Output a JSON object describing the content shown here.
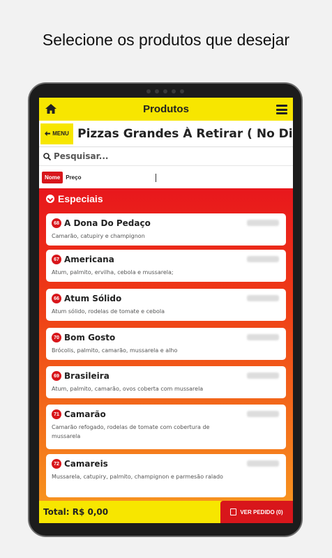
{
  "headline": "Selecione os produtos que desejar",
  "topbar": {
    "title": "Produtos"
  },
  "category": {
    "menu_label": "MENU",
    "title": "Pizzas Grandes À Retirar ( No Di..."
  },
  "search": {
    "placeholder": "Pesquisar..."
  },
  "sort": {
    "nome": "Nome",
    "preco": "Preço"
  },
  "section": {
    "title": "Especiais"
  },
  "products": [
    {
      "code": "68",
      "name": "A Dona Do Pedaço",
      "desc": "Camarão, catupiry e champignon"
    },
    {
      "code": "67",
      "name": "Americana",
      "desc": "Atum, palmito, ervilha, cebola e mussarela;"
    },
    {
      "code": "66",
      "name": "Atum Sólido",
      "desc": "Atum sólido, rodelas de tomate e cebola"
    },
    {
      "code": "70",
      "name": "Bom Gosto",
      "desc": "Brócolis, palmito, camarão, mussarela e alho"
    },
    {
      "code": "69",
      "name": "Brasileira",
      "desc": "Atum, palmito, camarão, ovos coberta com mussarela"
    },
    {
      "code": "71",
      "name": "Camarão",
      "desc": "Camarão refogado, rodelas de tomate com cobertura de mussarela"
    },
    {
      "code": "72",
      "name": "Camareis",
      "desc": "Mussarela, catupiry, palmito, champignon e parmesão ralado"
    }
  ],
  "footer": {
    "total": "Total: R$ 0,00",
    "ver_pedido": "VER PEDIDO (0)"
  },
  "colors": {
    "yellow": "#f7e600",
    "red": "#d8161b",
    "orange": "#f7921f"
  }
}
